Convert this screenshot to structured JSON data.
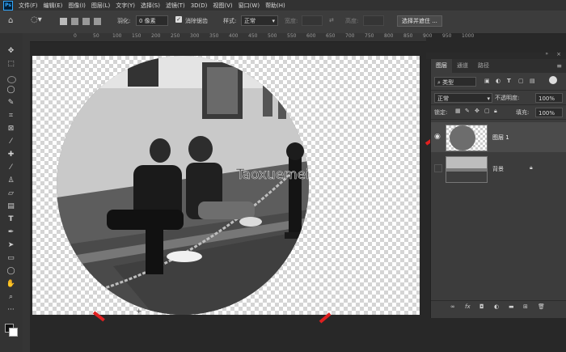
{
  "app": {
    "logo": "Ps"
  },
  "menu": [
    "文件(F)",
    "编辑(E)",
    "图像(I)",
    "图层(L)",
    "文字(Y)",
    "选择(S)",
    "滤镜(T)",
    "3D(D)",
    "视图(V)",
    "窗口(W)",
    "帮助(H)"
  ],
  "options": {
    "feather_label": "羽化:",
    "feather_value": "0 像素",
    "antialias_label": "消除锯齿",
    "style_label": "样式:",
    "style_value": "正常",
    "width_label": "宽度:",
    "height_label": "高度:",
    "select_mask_button": "选择并遮住 ..."
  },
  "ruler_ticks": [
    "0",
    "50",
    "100",
    "150",
    "200",
    "250",
    "300",
    "350",
    "400",
    "450",
    "500",
    "550",
    "600",
    "650",
    "700",
    "750",
    "800",
    "850",
    "900",
    "950",
    "1000"
  ],
  "canvas": {
    "watermark": "Taoxuemei.com"
  },
  "layers_panel": {
    "tabs": [
      "图层",
      "通道",
      "路径"
    ],
    "active_tab": 0,
    "kind_filter": "类型",
    "blend_mode": "正常",
    "opacity_label": "不透明度:",
    "opacity_value": "100%",
    "lock_label": "锁定:",
    "fill_label": "填充:",
    "fill_value": "100%",
    "layers": [
      {
        "name": "图层 1",
        "visible": true,
        "selected": true
      },
      {
        "name": "背景",
        "visible": false,
        "selected": false,
        "locked": true
      }
    ]
  },
  "colors": {
    "accent_arrow": "#e02020",
    "panel_bg": "#3c3c3c",
    "selected_layer": "#4b4b4b"
  }
}
